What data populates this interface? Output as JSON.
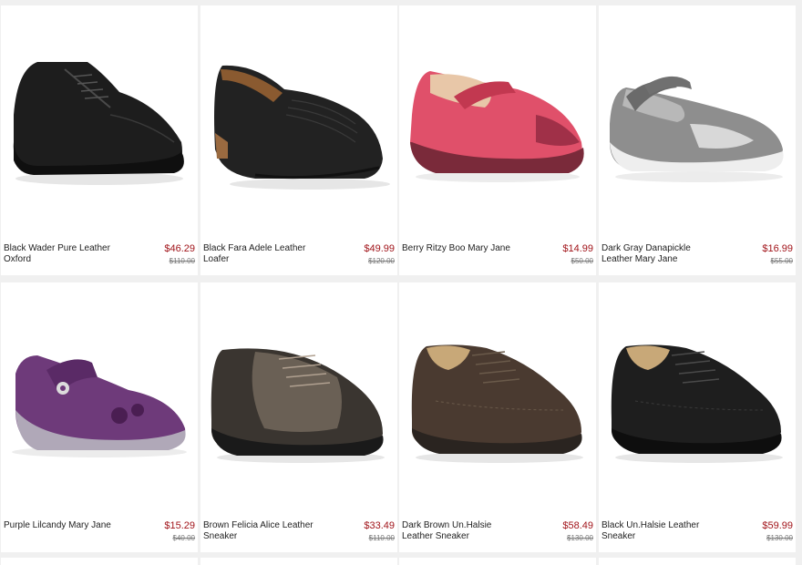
{
  "products": [
    {
      "name": "Black Wader Pure Leather Oxford",
      "price": "$46.29",
      "was": "$110.00",
      "shoe": "oxford",
      "color": "#1d1d1d",
      "accent": "#2c2c2c"
    },
    {
      "name": "Black Fara Adele Leather Loafer",
      "price": "$49.99",
      "was": "$120.00",
      "shoe": "loafer",
      "color": "#222222",
      "accent": "#8a5a30"
    },
    {
      "name": "Berry Ritzy Boo Mary Jane",
      "price": "$14.99",
      "was": "$50.00",
      "shoe": "maryjane-kid",
      "color": "#e0506a",
      "accent": "#7a2a3a"
    },
    {
      "name": "Dark Gray Danapickle Leather Mary Jane",
      "price": "$16.99",
      "was": "$55.00",
      "shoe": "maryjane-flat",
      "color": "#8e8e8e",
      "accent": "#d8d8d8"
    },
    {
      "name": "Purple Lilcandy Mary Jane",
      "price": "$15.29",
      "was": "$40.00",
      "shoe": "maryjane-kid",
      "color": "#6e3a7a",
      "accent": "#b0a8b8"
    },
    {
      "name": "Brown Felicia Alice Leather Sneaker",
      "price": "$33.49",
      "was": "$110.00",
      "shoe": "sneaker",
      "color": "#3a3530",
      "accent": "#6a6055"
    },
    {
      "name": "Dark Brown Un.Halsie Leather Sneaker",
      "price": "$58.49",
      "was": "$130.00",
      "shoe": "sneaker",
      "color": "#4a3a30",
      "accent": "#2a2420"
    },
    {
      "name": "Black Un.Halsie Leather Sneaker",
      "price": "$59.99",
      "was": "$130.00",
      "shoe": "sneaker",
      "color": "#1e1e1e",
      "accent": "#2a2a2a"
    }
  ]
}
